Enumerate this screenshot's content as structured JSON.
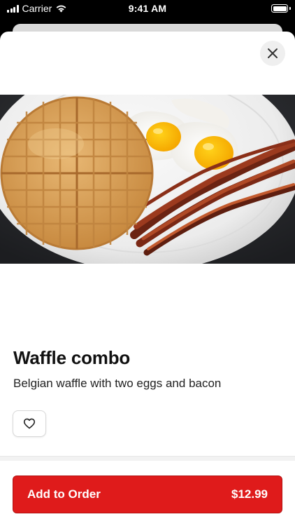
{
  "status_bar": {
    "carrier": "Carrier",
    "time": "9:41 AM"
  },
  "product": {
    "title": "Waffle combo",
    "description": "Belgian waffle with two eggs and bacon"
  },
  "actions": {
    "add_label": "Add to Order",
    "price": "$12.99"
  },
  "colors": {
    "accent": "#df1b1b"
  },
  "icons": {
    "close": "close-icon",
    "favorite": "heart-outline-icon"
  }
}
